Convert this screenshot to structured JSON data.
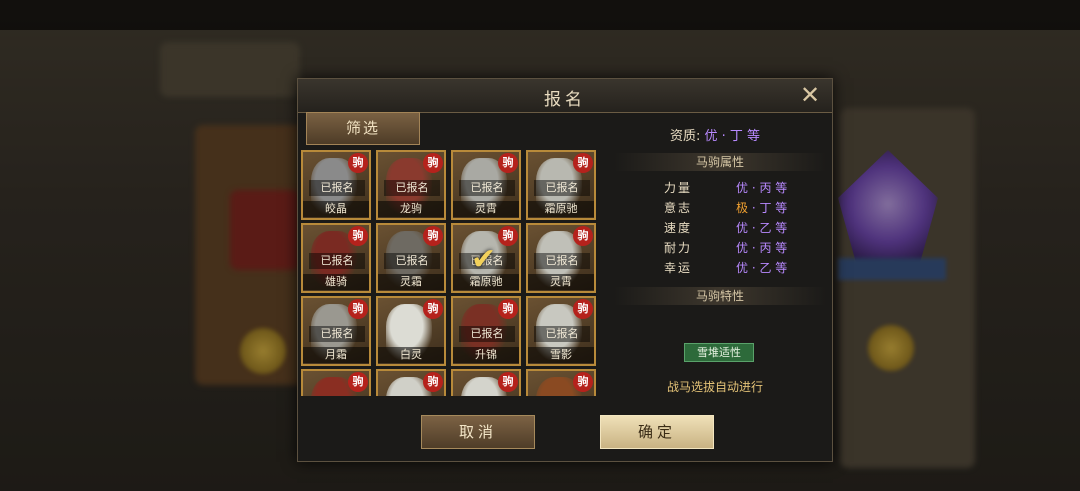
{
  "dialog": {
    "title": "报名",
    "filter_label": "筛选",
    "cancel_label": "取消",
    "confirm_label": "确定"
  },
  "horses": [
    {
      "name": "皎晶",
      "badge": "驹",
      "registered_text": "已报名",
      "color": "#8a8a8a"
    },
    {
      "name": "龙驹",
      "badge": "驹",
      "registered_text": "已报名",
      "color": "#8a3a2e"
    },
    {
      "name": "灵霄",
      "badge": "驹",
      "registered_text": "已报名",
      "color": "#a9a9a3"
    },
    {
      "name": "霜原驰",
      "badge": "驹",
      "registered_text": "已报名",
      "color": "#b8b8b0"
    },
    {
      "name": "雄骑",
      "badge": "驹",
      "registered_text": "已报名",
      "color": "#7a2a22"
    },
    {
      "name": "灵霜",
      "badge": "驹",
      "registered_text": "已报名",
      "color": "#6e6a62"
    },
    {
      "name": "霜原驰",
      "badge": "驹",
      "registered_text": "已报名",
      "color": "#b6b6ae",
      "selected": true
    },
    {
      "name": "灵霄",
      "badge": "驹",
      "registered_text": "已报名",
      "color": "#c0c0b8"
    },
    {
      "name": "月霜",
      "badge": "驹",
      "registered_text": "已报名",
      "color": "#9a9890"
    },
    {
      "name": "白灵",
      "badge": "驹",
      "registered_text": "",
      "color": "#dcdcd4"
    },
    {
      "name": "升锦",
      "badge": "驹",
      "registered_text": "已报名",
      "color": "#7a3024"
    },
    {
      "name": "雪影",
      "badge": "驹",
      "registered_text": "已报名",
      "color": "#c8c8c0"
    },
    {
      "name": "",
      "badge": "驹",
      "registered_text": "",
      "color": "#8a2e22"
    },
    {
      "name": "",
      "badge": "驹",
      "registered_text": "",
      "color": "#d0d0c8"
    },
    {
      "name": "",
      "badge": "驹",
      "registered_text": "",
      "color": "#d4d4cc"
    },
    {
      "name": "",
      "badge": "驹",
      "registered_text": "",
      "color": "#8a4a22"
    }
  ],
  "info": {
    "aptitude_label": "资质:",
    "aptitude_value": "优 · 丁 等",
    "attributes_header": "马驹属性",
    "attributes": [
      {
        "name": "力量",
        "value": "优 · 丙 等",
        "tier": "good"
      },
      {
        "name": "意志",
        "value_prefix": "极",
        "value_suffix": " · 丁 等",
        "tier": "best"
      },
      {
        "name": "速度",
        "value": "优 · 乙 等",
        "tier": "good"
      },
      {
        "name": "耐力",
        "value": "优 · 丙 等",
        "tier": "good"
      },
      {
        "name": "幸运",
        "value": "优 · 乙 等",
        "tier": "good"
      }
    ],
    "traits_header": "马驹特性",
    "trait": "雪堆适性",
    "auto_note": "战马选拔自动进行"
  },
  "colors": {
    "accent_gold": "#b88a3a",
    "badge_red": "#b5221c",
    "good_purple": "#b889ff",
    "best_orange": "#f0a030"
  }
}
